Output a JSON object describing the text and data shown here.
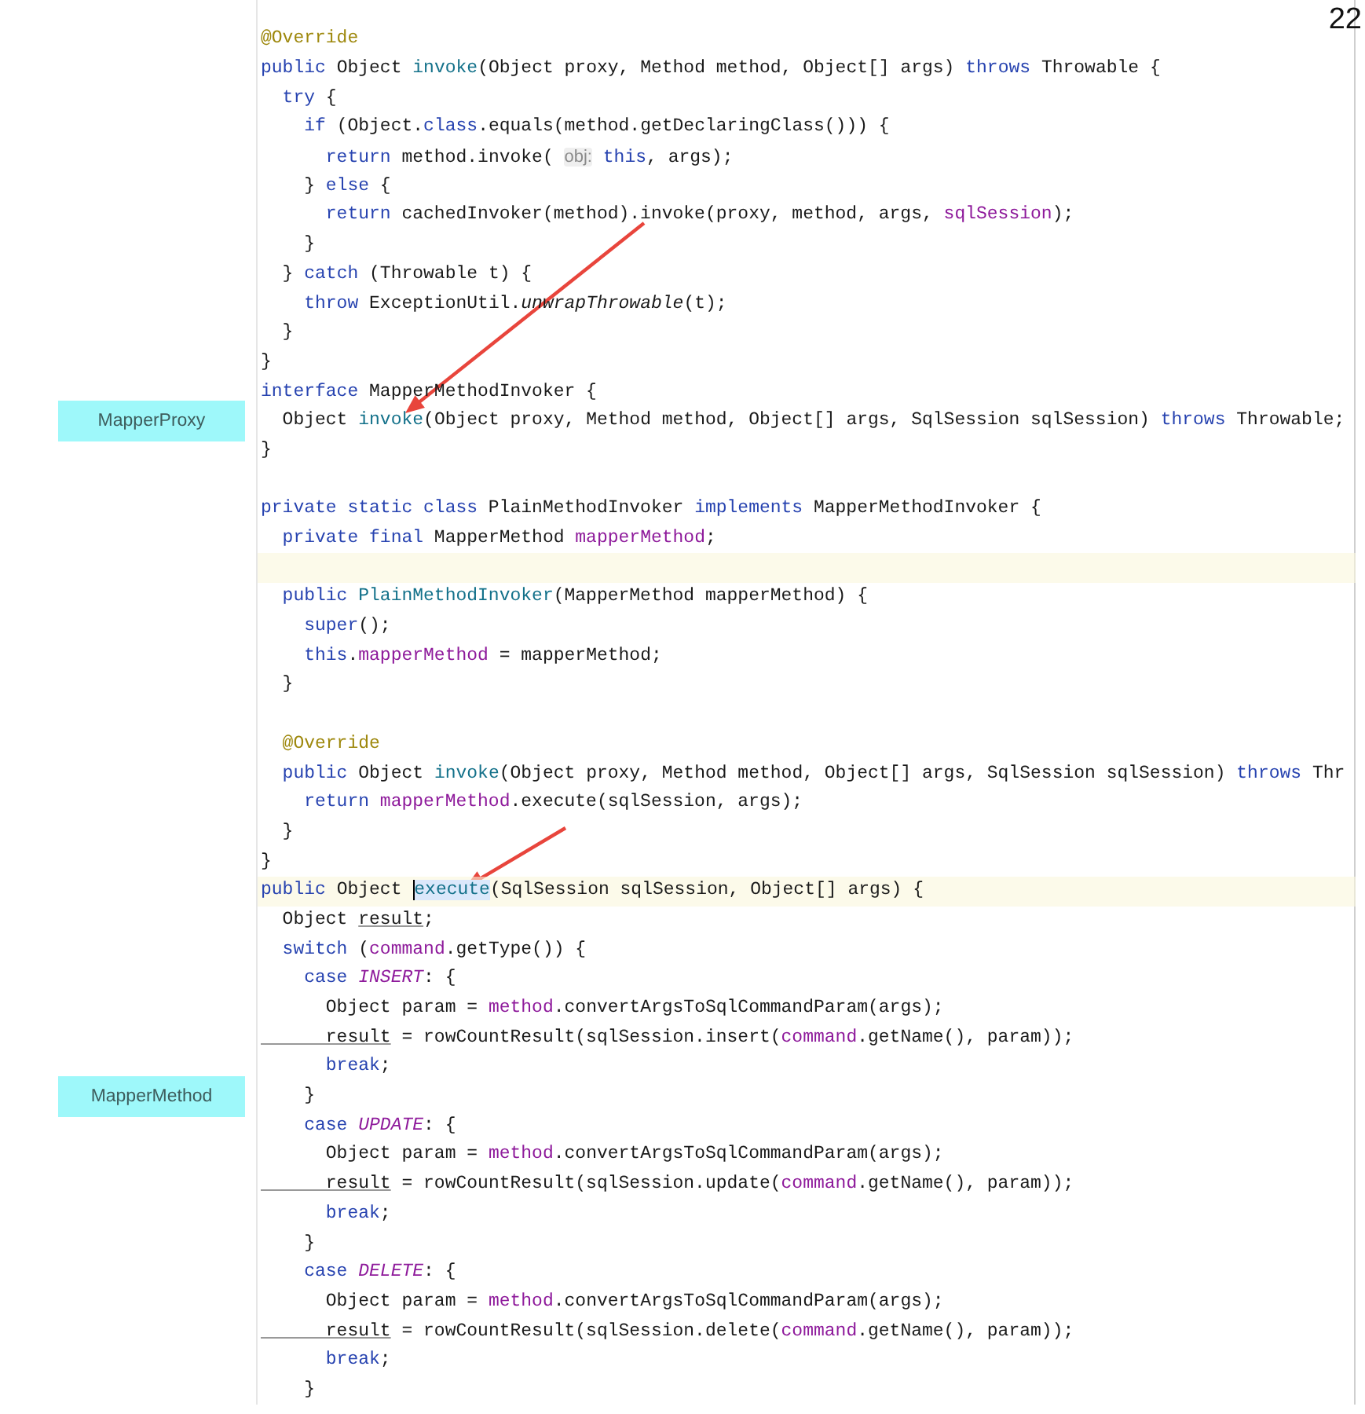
{
  "page_number": "22",
  "code_lines": [
    {
      "highlighted": false,
      "tokens": [
        {
          "text": "@Override",
          "kind": "annotation"
        }
      ]
    },
    {
      "highlighted": false,
      "tokens": [
        {
          "text": "public",
          "kind": "keyword"
        },
        {
          "text": " Object ",
          "kind": "plain"
        },
        {
          "text": "invoke",
          "kind": "declaration"
        },
        {
          "text": "(Object proxy, Method method, Object[] args) ",
          "kind": "plain"
        },
        {
          "text": "throws",
          "kind": "keyword"
        },
        {
          "text": " Throwable {",
          "kind": "plain"
        }
      ]
    },
    {
      "highlighted": false,
      "tokens": [
        {
          "text": "  try",
          "kind": "keyword"
        },
        {
          "text": " {",
          "kind": "plain"
        }
      ]
    },
    {
      "highlighted": false,
      "tokens": [
        {
          "text": "    if",
          "kind": "keyword"
        },
        {
          "text": " (Object.",
          "kind": "plain"
        },
        {
          "text": "class",
          "kind": "keyword"
        },
        {
          "text": ".equals(method.getDeclaringClass())) {",
          "kind": "plain"
        }
      ]
    },
    {
      "highlighted": false,
      "tokens": [
        {
          "text": "      return",
          "kind": "keyword"
        },
        {
          "text": " method.invoke( ",
          "kind": "plain"
        },
        {
          "text": "obj:",
          "kind": "hint"
        },
        {
          "text": " this",
          "kind": "keyword"
        },
        {
          "text": ", args);",
          "kind": "plain"
        }
      ]
    },
    {
      "highlighted": false,
      "tokens": [
        {
          "text": "    } ",
          "kind": "plain"
        },
        {
          "text": "else",
          "kind": "keyword"
        },
        {
          "text": " {",
          "kind": "plain"
        }
      ]
    },
    {
      "highlighted": false,
      "tokens": [
        {
          "text": "      return",
          "kind": "keyword"
        },
        {
          "text": " cachedInvoker(method).invoke(proxy, method, args, ",
          "kind": "plain"
        },
        {
          "text": "sqlSession",
          "kind": "field"
        },
        {
          "text": ");",
          "kind": "plain"
        }
      ]
    },
    {
      "highlighted": false,
      "tokens": [
        {
          "text": "    }",
          "kind": "plain"
        }
      ]
    },
    {
      "highlighted": false,
      "tokens": [
        {
          "text": "  } ",
          "kind": "plain"
        },
        {
          "text": "catch",
          "kind": "keyword"
        },
        {
          "text": " (Throwable t) {",
          "kind": "plain"
        }
      ]
    },
    {
      "highlighted": false,
      "tokens": [
        {
          "text": "    throw",
          "kind": "keyword"
        },
        {
          "text": " ExceptionUtil.",
          "kind": "plain"
        },
        {
          "text": "unwrapThrowable",
          "kind": "static-call"
        },
        {
          "text": "(t);",
          "kind": "plain"
        }
      ]
    },
    {
      "highlighted": false,
      "tokens": [
        {
          "text": "  }",
          "kind": "plain"
        }
      ]
    },
    {
      "highlighted": false,
      "tokens": [
        {
          "text": "}",
          "kind": "plain"
        }
      ]
    },
    {
      "highlighted": false,
      "tokens": [
        {
          "text": "interface",
          "kind": "keyword"
        },
        {
          "text": " MapperMethodInvoker {",
          "kind": "plain"
        }
      ]
    },
    {
      "highlighted": false,
      "label": "MapperProxy",
      "tokens": [
        {
          "text": "  Object ",
          "kind": "plain"
        },
        {
          "text": "invoke",
          "kind": "declaration"
        },
        {
          "text": "(Object proxy, Method method, Object[] args, SqlSession sqlSession) ",
          "kind": "plain"
        },
        {
          "text": "throws",
          "kind": "keyword"
        },
        {
          "text": " Throwable;",
          "kind": "plain"
        }
      ]
    },
    {
      "highlighted": false,
      "tokens": [
        {
          "text": "}",
          "kind": "plain"
        }
      ]
    },
    {
      "highlighted": false
    },
    {
      "highlighted": false,
      "tokens": [
        {
          "text": "private static class",
          "kind": "keyword"
        },
        {
          "text": " PlainMethodInvoker ",
          "kind": "plain"
        },
        {
          "text": "implements",
          "kind": "keyword"
        },
        {
          "text": " MapperMethodInvoker {",
          "kind": "plain"
        }
      ]
    },
    {
      "highlighted": false,
      "tokens": [
        {
          "text": "  private final",
          "kind": "keyword"
        },
        {
          "text": " MapperMethod ",
          "kind": "plain"
        },
        {
          "text": "mapperMethod",
          "kind": "field"
        },
        {
          "text": ";",
          "kind": "plain"
        }
      ]
    },
    {
      "highlighted": true
    },
    {
      "highlighted": false,
      "tokens": [
        {
          "text": "  public",
          "kind": "keyword"
        },
        {
          "text": " PlainMethodInvoker",
          "kind": "declaration"
        },
        {
          "text": "(MapperMethod mapperMethod) {",
          "kind": "plain"
        }
      ]
    },
    {
      "highlighted": false,
      "tokens": [
        {
          "text": "    super",
          "kind": "keyword"
        },
        {
          "text": "();",
          "kind": "plain"
        }
      ]
    },
    {
      "highlighted": false,
      "tokens": [
        {
          "text": "    this",
          "kind": "keyword"
        },
        {
          "text": ".",
          "kind": "plain"
        },
        {
          "text": "mapperMethod",
          "kind": "field"
        },
        {
          "text": " = mapperMethod;",
          "kind": "plain"
        }
      ]
    },
    {
      "highlighted": false,
      "tokens": [
        {
          "text": "  }",
          "kind": "plain"
        }
      ]
    },
    {
      "highlighted": false
    },
    {
      "highlighted": false,
      "tokens": [
        {
          "text": "  @Override",
          "kind": "annotation"
        }
      ]
    },
    {
      "highlighted": false,
      "tokens": [
        {
          "text": "  public",
          "kind": "keyword"
        },
        {
          "text": " Object ",
          "kind": "plain"
        },
        {
          "text": "invoke",
          "kind": "declaration"
        },
        {
          "text": "(Object proxy, Method method, Object[] args, SqlSession sqlSession) ",
          "kind": "plain"
        },
        {
          "text": "throws",
          "kind": "keyword"
        },
        {
          "text": " Thr",
          "kind": "plain"
        }
      ]
    },
    {
      "highlighted": false,
      "tokens": [
        {
          "text": "    return",
          "kind": "keyword"
        },
        {
          "text": " mapperMethod",
          "kind": "field"
        },
        {
          "text": ".execute(sqlSession, args);",
          "kind": "plain"
        }
      ]
    },
    {
      "highlighted": false,
      "tokens": [
        {
          "text": "  }",
          "kind": "plain"
        }
      ]
    },
    {
      "highlighted": false,
      "tokens": [
        {
          "text": "}",
          "kind": "plain"
        }
      ]
    },
    {
      "highlighted": true,
      "tokens": [
        {
          "text": "public",
          "kind": "keyword"
        },
        {
          "text": " Object ",
          "kind": "plain"
        },
        {
          "text": "execute",
          "kind": "selected-declaration"
        },
        {
          "text": "(SqlSession sqlSession, Object[] args) {",
          "kind": "plain"
        }
      ]
    },
    {
      "highlighted": false,
      "tokens": [
        {
          "text": "  Object ",
          "kind": "plain"
        },
        {
          "text": "result",
          "kind": "reassigned"
        },
        {
          "text": ";",
          "kind": "plain"
        }
      ]
    },
    {
      "highlighted": false,
      "tokens": [
        {
          "text": "  switch",
          "kind": "keyword"
        },
        {
          "text": " (",
          "kind": "plain"
        },
        {
          "text": "command",
          "kind": "field"
        },
        {
          "text": ".getType()) {",
          "kind": "plain"
        }
      ]
    },
    {
      "highlighted": false,
      "tokens": [
        {
          "text": "    case",
          "kind": "keyword"
        },
        {
          "text": " INSERT",
          "kind": "constant"
        },
        {
          "text": ": {",
          "kind": "plain"
        }
      ]
    },
    {
      "highlighted": false,
      "tokens": [
        {
          "text": "      Object param = ",
          "kind": "plain"
        },
        {
          "text": "method",
          "kind": "field"
        },
        {
          "text": ".convertArgsToSqlCommandParam(args);",
          "kind": "plain"
        }
      ]
    },
    {
      "highlighted": false,
      "tokens": [
        {
          "text": "      result",
          "kind": "reassigned"
        },
        {
          "text": " = rowCountResult(sqlSession.insert(",
          "kind": "plain"
        },
        {
          "text": "command",
          "kind": "field"
        },
        {
          "text": ".getName(), param));",
          "kind": "plain"
        }
      ]
    },
    {
      "highlighted": false,
      "tokens": [
        {
          "text": "      break",
          "kind": "keyword"
        },
        {
          "text": ";",
          "kind": "plain"
        }
      ]
    },
    {
      "highlighted": false,
      "label": "MapperMethod",
      "tokens": [
        {
          "text": "    }",
          "kind": "plain"
        }
      ]
    },
    {
      "highlighted": false,
      "tokens": [
        {
          "text": "    case",
          "kind": "keyword"
        },
        {
          "text": " UPDATE",
          "kind": "constant"
        },
        {
          "text": ": {",
          "kind": "plain"
        }
      ]
    },
    {
      "highlighted": false,
      "tokens": [
        {
          "text": "      Object param = ",
          "kind": "plain"
        },
        {
          "text": "method",
          "kind": "field"
        },
        {
          "text": ".convertArgsToSqlCommandParam(args);",
          "kind": "plain"
        }
      ]
    },
    {
      "highlighted": false,
      "tokens": [
        {
          "text": "      result",
          "kind": "reassigned"
        },
        {
          "text": " = rowCountResult(sqlSession.update(",
          "kind": "plain"
        },
        {
          "text": "command",
          "kind": "field"
        },
        {
          "text": ".getName(), param));",
          "kind": "plain"
        }
      ]
    },
    {
      "highlighted": false,
      "tokens": [
        {
          "text": "      break",
          "kind": "keyword"
        },
        {
          "text": ";",
          "kind": "plain"
        }
      ]
    },
    {
      "highlighted": false,
      "tokens": [
        {
          "text": "    }",
          "kind": "plain"
        }
      ]
    },
    {
      "highlighted": false,
      "tokens": [
        {
          "text": "    case",
          "kind": "keyword"
        },
        {
          "text": " DELETE",
          "kind": "constant"
        },
        {
          "text": ": {",
          "kind": "plain"
        }
      ]
    },
    {
      "highlighted": false,
      "tokens": [
        {
          "text": "      Object param = ",
          "kind": "plain"
        },
        {
          "text": "method",
          "kind": "field"
        },
        {
          "text": ".convertArgsToSqlCommandParam(args);",
          "kind": "plain"
        }
      ]
    },
    {
      "highlighted": false,
      "tokens": [
        {
          "text": "      result",
          "kind": "reassigned"
        },
        {
          "text": " = rowCountResult(sqlSession.delete(",
          "kind": "plain"
        },
        {
          "text": "command",
          "kind": "field"
        },
        {
          "text": ".getName(), param));",
          "kind": "plain"
        }
      ]
    },
    {
      "highlighted": false,
      "tokens": [
        {
          "text": "      break",
          "kind": "keyword"
        },
        {
          "text": ";",
          "kind": "plain"
        }
      ]
    },
    {
      "highlighted": false,
      "tokens": [
        {
          "text": "    }",
          "kind": "plain"
        }
      ]
    }
  ]
}
